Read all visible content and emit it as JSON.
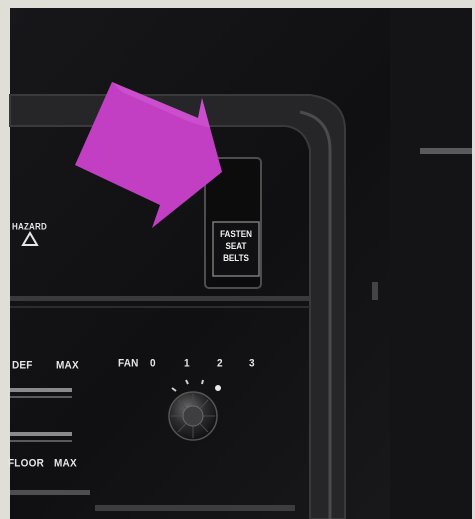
{
  "image": {
    "subject": "car-dashboard-seat-belt-warning-light",
    "arrow_color": "#c23fc3",
    "panel_color": "#1a1a1d"
  },
  "labels": {
    "hazard": "HAZARD",
    "warning_light": [
      "FASTEN",
      "SEAT",
      "BELTS"
    ],
    "def": "DEF",
    "max_top": "MAX",
    "fan": "FAN",
    "fan_speeds": [
      "0",
      "1",
      "2",
      "3"
    ],
    "floor": "FLOOR",
    "max_bottom": "MAX"
  }
}
